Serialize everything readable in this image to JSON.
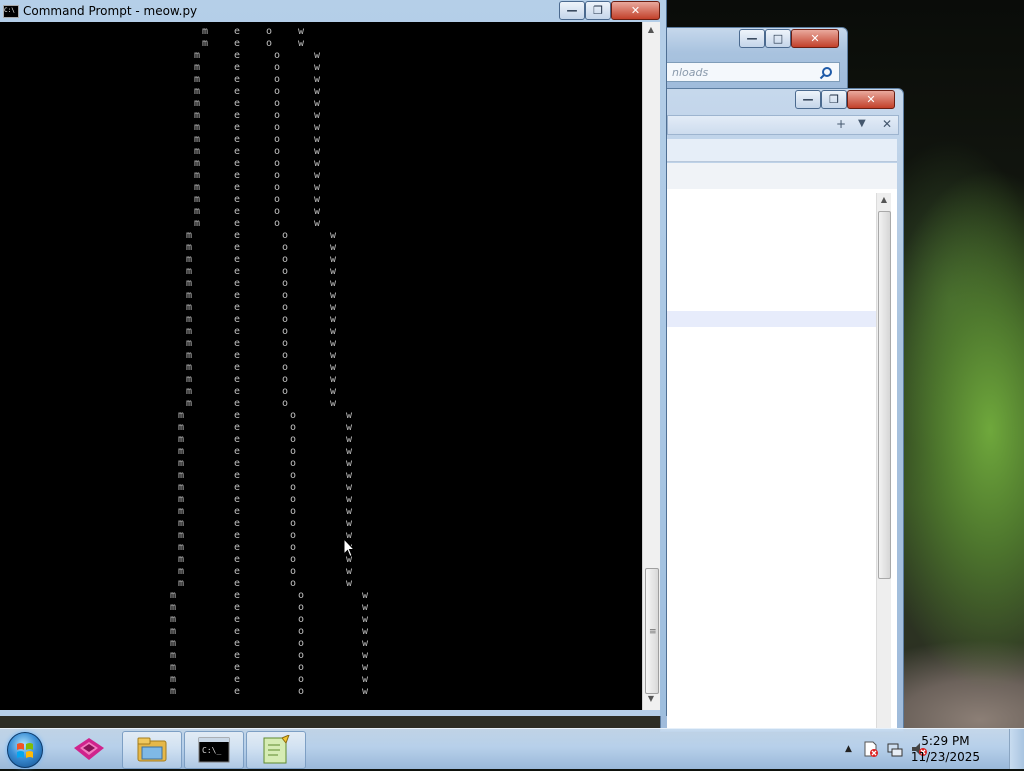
{
  "cmd_window": {
    "title": "Command Prompt - meow.py",
    "icon_text": "C:\\",
    "minimize": "—",
    "restore": "❐",
    "close": "✕"
  },
  "console_chars": [
    "m",
    "e",
    "o",
    "w"
  ],
  "background_windows": {
    "explorer_search_placeholder": "nloads",
    "explorer_minimize": "—",
    "explorer_maximize": "□",
    "explorer_restore": "❐",
    "explorer_close": "✕",
    "toolbar_add": "+",
    "toolbar_dropdown": "▼",
    "toolbar_close": "✕"
  },
  "taskbar": {
    "pinned": [
      {
        "name": "start",
        "icon": "windows-logo-icon"
      },
      {
        "name": "app-purple",
        "icon": "purple-diamond-icon"
      },
      {
        "name": "file-explorer",
        "icon": "folder-icon"
      },
      {
        "name": "command-prompt",
        "icon": "console-icon",
        "active": true
      },
      {
        "name": "notepad-plus",
        "icon": "notepad-icon"
      }
    ],
    "clock_time": "5:29 PM",
    "clock_date": "11/23/2025"
  }
}
